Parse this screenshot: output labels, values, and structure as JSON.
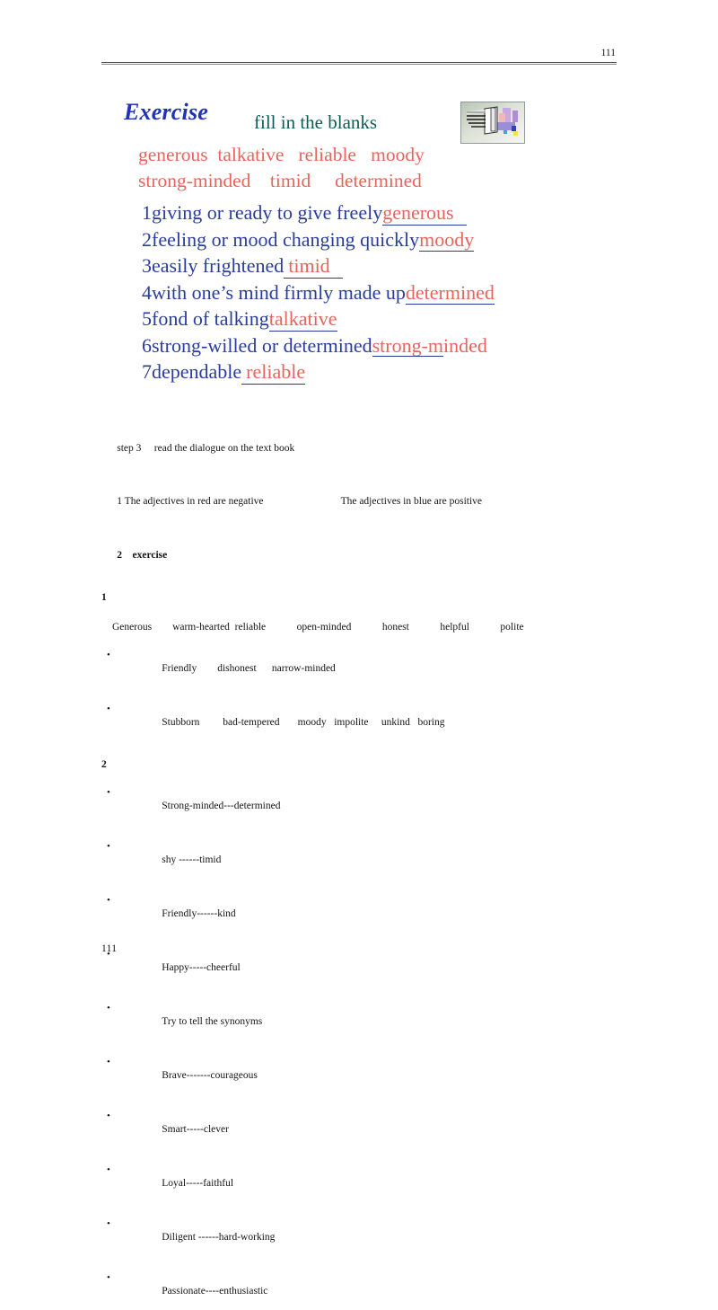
{
  "header": {
    "page_number": "111"
  },
  "slide": {
    "title": "Exercise",
    "subtitle": "fill in the blanks",
    "clipart_name": "presentation-clipart",
    "word_bank": {
      "color": "#e8645c",
      "lines": [
        "generous  talkative   reliable   moody",
        "strong-minded    timid     determined"
      ],
      "words": [
        "generous",
        "talkative",
        "reliable",
        "moody",
        "strong-minded",
        "timid",
        "determined"
      ]
    },
    "definitions": [
      {
        "num": "1",
        "prompt": "giving or ready to give freely",
        "answer": "generous",
        "blank_style": "pad-r"
      },
      {
        "num": "2",
        "prompt": "feeling or mood changing quickly",
        "answer": "moody",
        "blank_style": "plain"
      },
      {
        "num": "3",
        "prompt": "easily frightened",
        "answer": "timid",
        "blank_style": "pad-lr"
      },
      {
        "num": "4",
        "prompt": "with one’s mind firmly made up",
        "answer": "determined",
        "blank_style": "plain"
      },
      {
        "num": "5",
        "prompt": "fond of talking",
        "answer": "talkative",
        "blank_style": "plain"
      },
      {
        "num": "6",
        "prompt": "strong-willed or determined",
        "answer": "strong-minded",
        "blank_style": "short"
      },
      {
        "num": "7",
        "prompt": "dependable",
        "answer": "reliable",
        "blank_style": "pad-l"
      }
    ],
    "colors": {
      "title": "#1f33b4",
      "subtitle": "#0d5c55",
      "prompt": "#2a3c9e",
      "answer": "#e8645c"
    }
  },
  "body": {
    "step_label": "step 3",
    "step_text": "read the dialogue on the text book",
    "note_left": "1 The adjectives in red are negative",
    "note_right": "The adjectives in blue are positive",
    "section_num": "2",
    "section_label": "exercise",
    "sub_one": "1",
    "positive_words_row": "Generous        warm-hearted  reliable            open-minded            honest            helpful            polite",
    "word_bullets": [
      "Friendly        dishonest      narrow-minded",
      "Stubborn         bad-tempered       moody   impolite     unkind   boring"
    ],
    "sub_two": "2",
    "synonym_bullets": [
      "Strong-minded---determined",
      "shy ------timid",
      "Friendly------kind",
      "Happy-----cheerful",
      "Try to tell the synonyms",
      "Brave-------courageous",
      "Smart-----clever",
      "Loyal-----faithful",
      "Diligent ------hard-working",
      "Passionate----enthusiastic"
    ],
    "bullet_glyph": "•"
  },
  "footer": {
    "page_number": "111"
  }
}
